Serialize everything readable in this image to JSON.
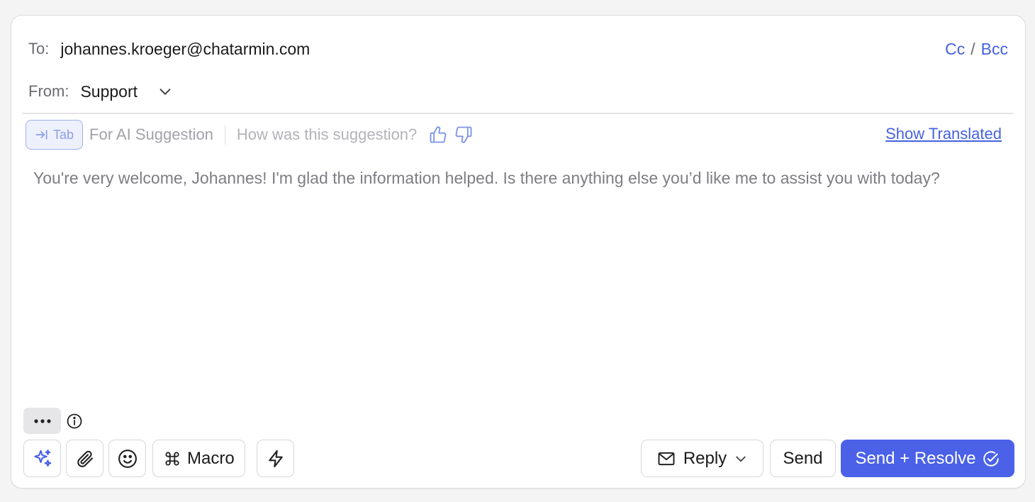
{
  "header": {
    "to_label": "To:",
    "to_value": "johannes.kroeger@chatarmin.com",
    "cc_label": "Cc",
    "cc_separator": "/",
    "bcc_label": "Bcc",
    "from_label": "From:",
    "from_value": "Support",
    "from_icon": "chevron-down-icon"
  },
  "ai_bar": {
    "tab_key_label": "Tab",
    "tab_key_icon": "tab-arrow-icon",
    "hint": "For AI Suggestion",
    "question": "How was this suggestion?",
    "feedback_icons": [
      "thumbs-up-icon",
      "thumbs-down-icon"
    ],
    "show_translated": "Show Translated"
  },
  "suggestion_text": "You're very welcome, Johannes! I'm glad the information helped. Is there anything else you’d like me to assist you with today?",
  "toolbar": {
    "more_icon": "ellipsis-icon",
    "info_icon": "info-icon",
    "tools": [
      "sparkles-icon",
      "paperclip-icon",
      "smiley-icon"
    ],
    "macro_label": "Macro",
    "macro_icon": "command-icon",
    "quick_action_icon": "lightning-icon",
    "reply_label": "Reply",
    "reply_icon": "mail-icon",
    "send_label": "Send",
    "send_resolve_label": "Send + Resolve",
    "send_resolve_icon": "check-circle-icon"
  },
  "colors": {
    "accent": "#4a61e8",
    "link": "#4661e0",
    "muted_text": "#7d7d83",
    "tab_key_border": "#9fb0ee"
  }
}
